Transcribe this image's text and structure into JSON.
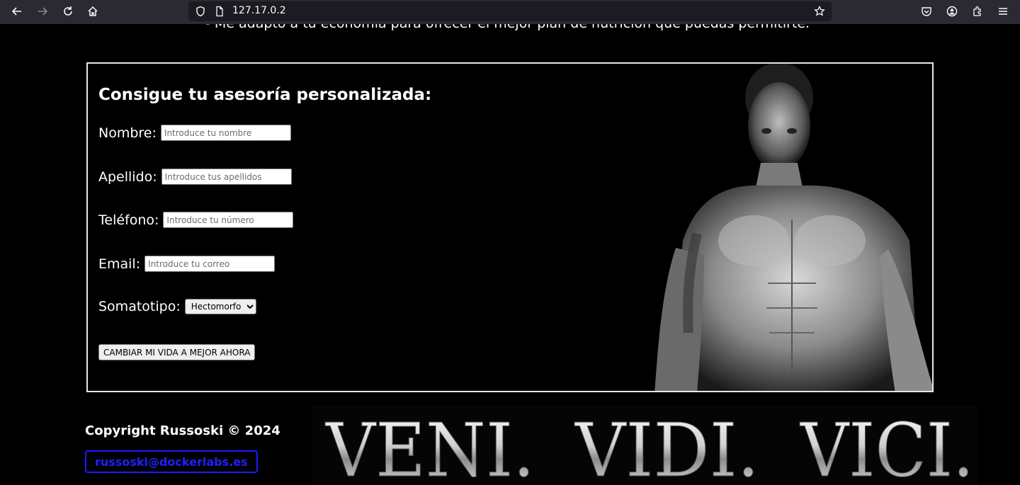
{
  "browser": {
    "url": "127.17.0.2"
  },
  "page": {
    "top_line": "- Me adapto a tu economía para ofrecer el mejor plan de nutrición que puedas permitirte.",
    "form": {
      "title": "Consigue tu asesoría personalizada:",
      "fields": [
        {
          "label": "Nombre:",
          "placeholder": "Introduce tu nombre"
        },
        {
          "label": "Apellido:",
          "placeholder": "Introduce tus apellidos"
        },
        {
          "label": "Teléfono:",
          "placeholder": "Introduce tu número"
        },
        {
          "label": "Email:",
          "placeholder": "Introduce tu correo"
        }
      ],
      "somatotipo_label": "Somatotipo:",
      "somatotipo_selected": "Hectomorfo",
      "submit_label": "CAMBIAR MI VIDA A MEJOR AHORA"
    },
    "footer": {
      "copyright": "Copyright Russoski © 2024",
      "email": "russoski@dockerlabs.es",
      "banner_words": [
        "VENI.",
        "VIDI.",
        "VICI."
      ]
    }
  }
}
